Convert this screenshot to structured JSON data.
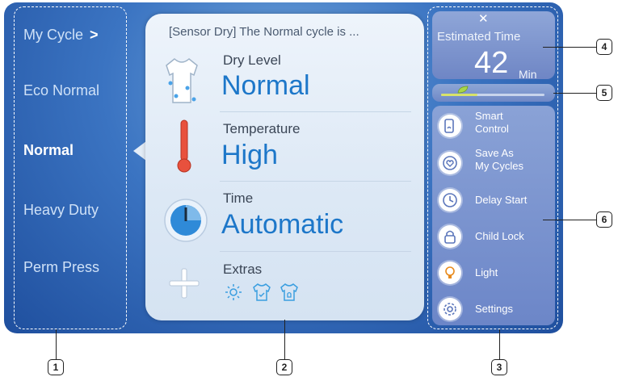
{
  "cycles": {
    "items": [
      "My Cycle",
      "Eco Normal",
      "Normal",
      "Heavy Duty",
      "Perm Press"
    ],
    "selected": "Normal"
  },
  "panel": {
    "header": "[Sensor Dry] The Normal cycle is ...",
    "dry_level": {
      "label": "Dry Level",
      "value": "Normal",
      "icon": "shirt-icon"
    },
    "temperature": {
      "label": "Temperature",
      "value": "High",
      "icon": "thermometer-icon"
    },
    "time": {
      "label": "Time",
      "value": "Automatic",
      "icon": "timer-dial-icon"
    },
    "extras": {
      "label": "Extras",
      "icons": [
        "sun-icon",
        "shirt-check-icon",
        "shirt-bell-icon"
      ]
    }
  },
  "estimated": {
    "label": "Estimated Time",
    "value": "42",
    "unit": "Min"
  },
  "eco_level": 0.35,
  "options": [
    {
      "label_line1": "Smart",
      "label_line2": "Control",
      "icon": "smart-control-icon"
    },
    {
      "label_line1": "Save As",
      "label_line2": "My Cycles",
      "icon": "save-heart-icon"
    },
    {
      "label_line1": "Delay Start",
      "label_line2": "",
      "icon": "clock-icon"
    },
    {
      "label_line1": "Child Lock",
      "label_line2": "",
      "icon": "lock-icon"
    },
    {
      "label_line1": "Light",
      "label_line2": "",
      "icon": "bulb-icon"
    },
    {
      "label_line1": "Settings",
      "label_line2": "",
      "icon": "gear-icon"
    }
  ],
  "callouts": [
    "1",
    "2",
    "3",
    "4",
    "5",
    "6"
  ],
  "colors": {
    "accent": "#1d77c9",
    "screen": "#3b74c2",
    "option_bg": "#7a93cf"
  }
}
